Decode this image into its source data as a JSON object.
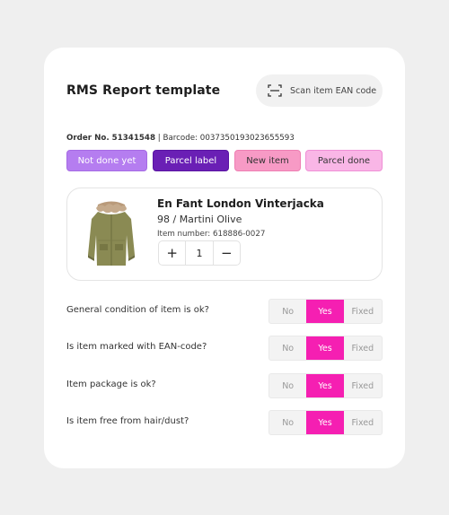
{
  "header": {
    "title": "RMS Report template",
    "scan_button_label": "Scan item EAN code",
    "scan_icon": "scan-icon"
  },
  "order": {
    "order_label": "Order No. 51341548",
    "barcode_label": "Barcode: 0037350193023655593"
  },
  "status_buttons": [
    {
      "label": "Not done yet",
      "color": "#b57df0"
    },
    {
      "label": "Parcel label",
      "color": "#6a1fb5"
    },
    {
      "label": "New item",
      "color": "#f79ac5"
    },
    {
      "label": "Parcel done",
      "color": "#f9b6e6"
    }
  ],
  "product": {
    "name": "En Fant London Vinterjacka",
    "variant": "98 / Martini Olive",
    "item_number": "Item number: 618886-0027",
    "quantity": "1",
    "plus_symbol": "+",
    "minus_symbol": "−",
    "image_icon": "jacket-image"
  },
  "questions": [
    {
      "text": "General condition of item is ok?",
      "selected": "Yes"
    },
    {
      "text": "Is item marked with EAN-code?",
      "selected": "Yes"
    },
    {
      "text": "Item package is ok?",
      "selected": "Yes"
    },
    {
      "text": "Is item free from hair/dust?",
      "selected": "Yes"
    }
  ],
  "answer_options": [
    "No",
    "Yes",
    "Fixed"
  ],
  "colors": {
    "accent": "#f51fb2",
    "background": "#efefef",
    "card": "#ffffff"
  }
}
